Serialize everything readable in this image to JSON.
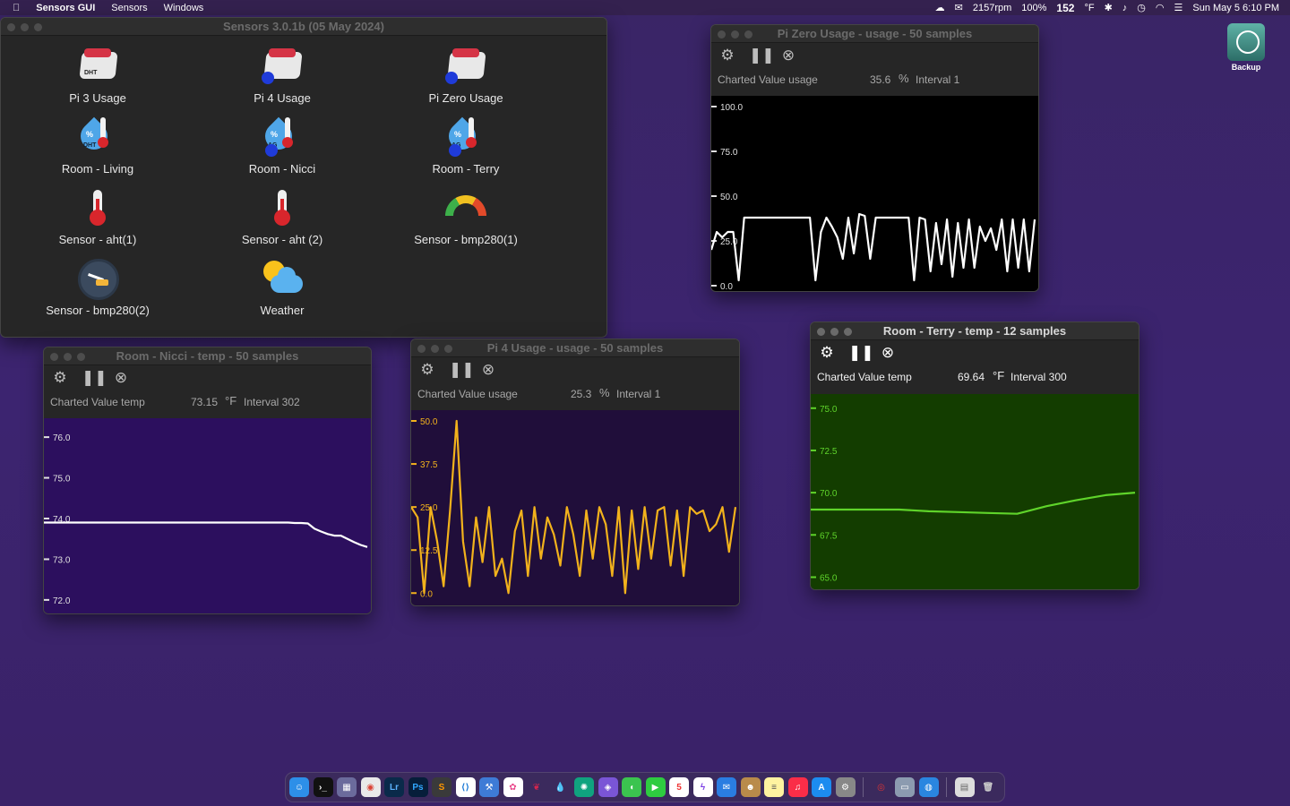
{
  "menubar": {
    "app_name": "Sensors GUI",
    "menus": [
      "Sensors",
      "Windows"
    ],
    "status": {
      "fan": "2157rpm",
      "battery": "100%",
      "cpu_temp": "152",
      "cpu_temp_unit": "°F",
      "datetime": "Sun May 5  6:10 PM"
    }
  },
  "desktop": {
    "backup_label": "Backup"
  },
  "main_window": {
    "title": "Sensors 3.0.1b (05 May 2024)",
    "tiles": [
      {
        "label": "Pi 3 Usage",
        "icon": "raspberry-pi-icon"
      },
      {
        "label": "Pi 4 Usage",
        "icon": "raspberry-pi-icon"
      },
      {
        "label": "Pi Zero Usage",
        "icon": "raspberry-pi-icon"
      },
      {
        "label": "Room - Living",
        "icon": "humidity-temp-icon",
        "badge": "DHT"
      },
      {
        "label": "Room - Nicci",
        "icon": "humidity-temp-icon",
        "badge": "AG"
      },
      {
        "label": "Room - Terry",
        "icon": "humidity-temp-icon",
        "badge": "AG"
      },
      {
        "label": "Sensor - aht(1)",
        "icon": "thermometer-icon"
      },
      {
        "label": "Sensor - aht (2)",
        "icon": "thermometer-icon"
      },
      {
        "label": "Sensor - bmp280(1)",
        "icon": "gauge-icon"
      },
      {
        "label": "Sensor - bmp280(2)",
        "icon": "speedometer-icon"
      },
      {
        "label": "Weather",
        "icon": "weather-icon"
      }
    ]
  },
  "windows": {
    "pizero": {
      "title": "Pi Zero Usage - usage  - 50 samples",
      "charted_label": "Charted Value usage",
      "value": "35.6",
      "unit": "%",
      "interval": "Interval 1"
    },
    "nicci": {
      "title": "Room - Nicci - temp  - 50 samples",
      "charted_label": "Charted Value temp",
      "value": "73.15",
      "unit": "°F",
      "interval": "Interval 302"
    },
    "pi4": {
      "title": "Pi 4 Usage - usage  - 50 samples",
      "charted_label": "Charted Value usage",
      "value": "25.3",
      "unit": "%",
      "interval": "Interval 1"
    },
    "terry": {
      "title": "Room - Terry - temp  - 12 samples",
      "charted_label": "Charted Value temp",
      "value": "69.64",
      "unit": "°F",
      "interval": "Interval 300"
    }
  },
  "chart_data": [
    {
      "id": "pizero",
      "type": "line",
      "title": "Pi Zero Usage - usage  - 50 samples",
      "ylim": [
        0,
        100
      ],
      "yticks": [
        "100.0",
        "75.0",
        "50.0",
        "25.0",
        "0.0"
      ],
      "background": "#000000",
      "line_color": "#ffffff",
      "series": [
        {
          "values": [
            20,
            30,
            27,
            30,
            30,
            3,
            38,
            38,
            38,
            38,
            38,
            38,
            38,
            38,
            38,
            38,
            38,
            38,
            38,
            3,
            30,
            38,
            33,
            27,
            15,
            38,
            18,
            40,
            39,
            15,
            38,
            38,
            38,
            38,
            38,
            38,
            38,
            3,
            38,
            37,
            8,
            35,
            12,
            37,
            5,
            35,
            10,
            37,
            10,
            33,
            25,
            32,
            20,
            37,
            8,
            37,
            10,
            37,
            8,
            37
          ]
        }
      ]
    },
    {
      "id": "nicci",
      "type": "line",
      "title": "Room - Nicci - temp  - 50 samples",
      "ylim": [
        71.8,
        76.2
      ],
      "yticks": [
        "76.0",
        "75.0",
        "74.0",
        "73.0",
        "72.0"
      ],
      "background": "#2c0f5e",
      "line_color": "#ffffff",
      "series": [
        {
          "values": [
            73.9,
            73.9,
            73.9,
            73.9,
            73.9,
            73.9,
            73.9,
            73.9,
            73.9,
            73.9,
            73.9,
            73.9,
            73.9,
            73.9,
            73.9,
            73.9,
            73.9,
            73.9,
            73.9,
            73.9,
            73.9,
            73.9,
            73.9,
            73.9,
            73.9,
            73.9,
            73.9,
            73.9,
            73.9,
            73.9,
            73.9,
            73.9,
            73.9,
            73.9,
            73.9,
            73.9,
            73.9,
            73.9,
            73.89,
            73.89,
            73.88,
            73.75,
            73.68,
            73.62,
            73.58,
            73.58,
            73.5,
            73.42,
            73.35,
            73.3
          ]
        }
      ]
    },
    {
      "id": "pi4",
      "type": "line",
      "title": "Pi 4 Usage - usage  - 50 samples",
      "ylim": [
        -2,
        50
      ],
      "yticks": [
        "50.0",
        "37.5",
        "25.0",
        "12.5",
        "0.0"
      ],
      "background": "#200e3a",
      "line_color": "#f2b21c",
      "series": [
        {
          "values": [
            25,
            22,
            0,
            25,
            15,
            2,
            24,
            50,
            15,
            2,
            22,
            9,
            25,
            5,
            10,
            0,
            18,
            24,
            5,
            25,
            10,
            22,
            17,
            8,
            25,
            17,
            5,
            24,
            10,
            25,
            20,
            5,
            25,
            0,
            24,
            7,
            25,
            10,
            24,
            25,
            8,
            24,
            5,
            25,
            23,
            24,
            18,
            20,
            25,
            12,
            25
          ]
        }
      ]
    },
    {
      "id": "terry",
      "type": "line",
      "title": "Room - Terry - temp  - 12 samples",
      "ylim": [
        64.6,
        75.2
      ],
      "yticks": [
        "75.0",
        "72.5",
        "70.0",
        "67.5",
        "65.0"
      ],
      "background": "#133d00",
      "line_color": "#5fd42a",
      "series": [
        {
          "values": [
            69.0,
            69.0,
            69.0,
            69.0,
            68.9,
            68.85,
            68.8,
            68.75,
            69.2,
            69.55,
            69.85,
            70.0
          ]
        }
      ]
    }
  ]
}
